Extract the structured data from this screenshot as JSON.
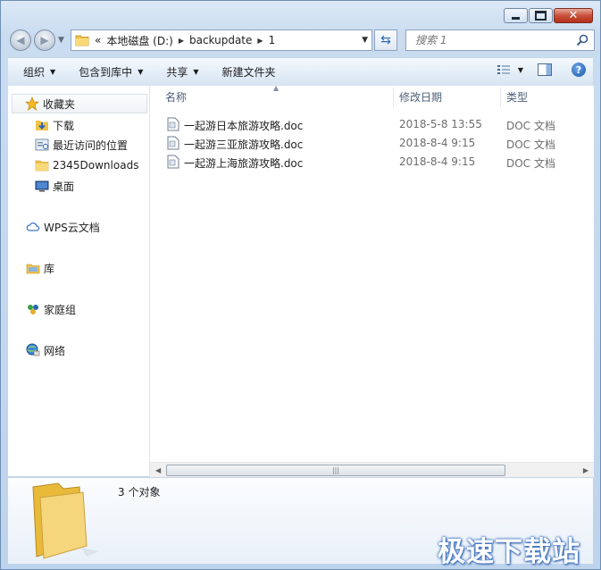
{
  "address": {
    "overflow": "«",
    "segments": [
      "本地磁盘 (D:)",
      "backupdate",
      "1"
    ]
  },
  "search": {
    "placeholder": "搜索 1"
  },
  "toolbar": {
    "organize": "组织",
    "include_in_library": "包含到库中",
    "share": "共享",
    "new_folder": "新建文件夹"
  },
  "nav": {
    "favorites": "收藏夹",
    "downloads": "下载",
    "recent": "最近访问的位置",
    "downloads2345": "2345Downloads",
    "desktop": "桌面",
    "wps_cloud": "WPS云文档",
    "libraries": "库",
    "homegroup": "家庭组",
    "network": "网络"
  },
  "columns": {
    "name": "名称",
    "date": "修改日期",
    "type": "类型"
  },
  "files": [
    {
      "name": "一起游日本旅游攻略.doc",
      "date": "2018-5-8 13:55",
      "type": "DOC 文档"
    },
    {
      "name": "一起游三亚旅游攻略.doc",
      "date": "2018-8-4 9:15",
      "type": "DOC 文档"
    },
    {
      "name": "一起游上海旅游攻略.doc",
      "date": "2018-8-4 9:15",
      "type": "DOC 文档"
    }
  ],
  "details": {
    "count": "3 个对象"
  },
  "watermark": "极速下载站",
  "colors": {
    "accent": "#2a66b5",
    "folder": "#f0c34a",
    "header_text": "#4c607a"
  }
}
